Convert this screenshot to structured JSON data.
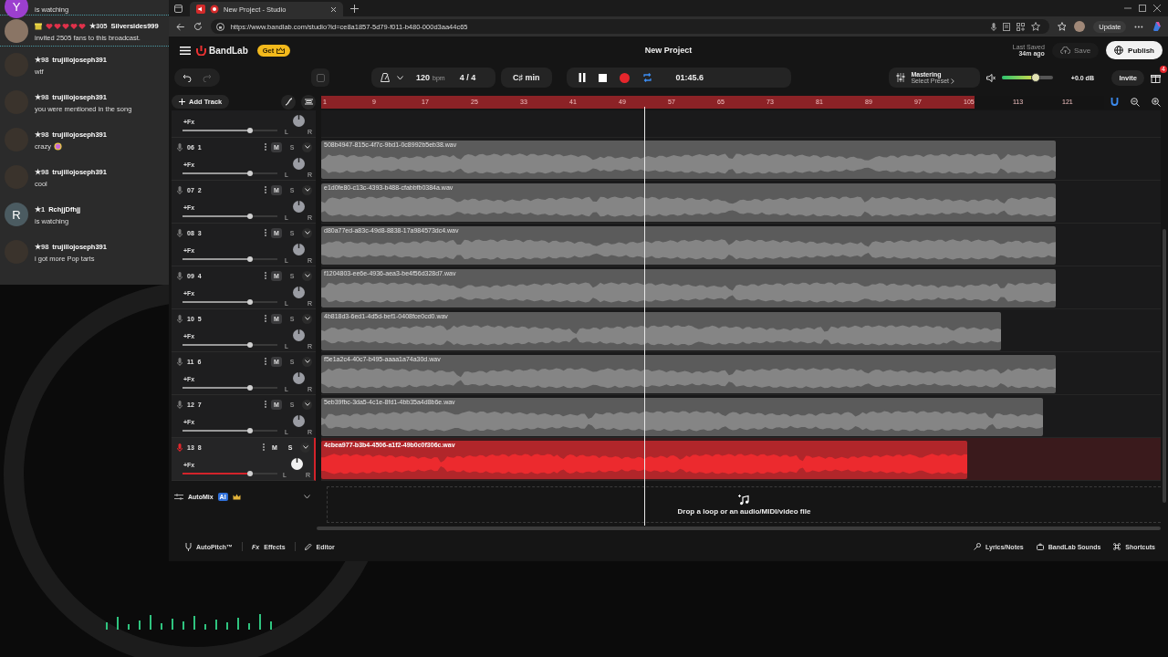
{
  "chat": {
    "messages": [
      {
        "kind": "letter",
        "avatar": "Y",
        "color": "#9c3fcf",
        "text": "is watching",
        "emoji": false
      },
      {
        "kind": "gift",
        "badge": "★305",
        "user": "Silversides999",
        "text": "invited 2505 fans to this broadcast.",
        "emoji": false
      },
      {
        "kind": "photo",
        "badge": "★98",
        "user": "trujillojoseph391",
        "text": "wtf",
        "emoji": false
      },
      {
        "kind": "photo",
        "badge": "★98",
        "user": "trujillojoseph391",
        "text": "you were mentioned in the song",
        "emoji": false
      },
      {
        "kind": "photo",
        "badge": "★98",
        "user": "trujillojoseph391",
        "text": "crazy",
        "emoji": true
      },
      {
        "kind": "photo",
        "badge": "★98",
        "user": "trujillojoseph391",
        "text": "cool",
        "emoji": false
      },
      {
        "kind": "letter",
        "avatar": "R",
        "color": "#4b5b61",
        "badge": "★1",
        "user": "RchjjDfhjj",
        "text": "is watching",
        "emoji": false
      },
      {
        "kind": "photo",
        "badge": "★98",
        "user": "trujillojoseph391",
        "text": "i got more Pop tarts",
        "emoji": false
      }
    ]
  },
  "browser": {
    "tab": {
      "title": "New Project - Studio"
    },
    "url": "https://www.bandlab.com/studio?id=ce8a1857-5d79-f011-b480-000d3aa44c65",
    "update": "Update"
  },
  "header": {
    "logo": "BandLab",
    "get": "Get",
    "title": "New Project",
    "last_saved_label": "Last Saved",
    "last_saved_time": "34m ago",
    "save": {
      "label": "Save",
      "disabled": true
    },
    "publish": "Publish"
  },
  "toolbar": {
    "tempo": "120",
    "tempo_unit": "bpm",
    "time_signature": "4 / 4",
    "key": "C♯ min",
    "transport": {
      "playing": true,
      "loop": true
    },
    "time": "01:45.6",
    "mastering": {
      "label": "Mastering",
      "preset": "Select Preset"
    },
    "master_volume": {
      "level": 0.65,
      "reading": "+0.0 dB"
    },
    "invite": "Invite",
    "gift_count": "4"
  },
  "add_track": "Add Track",
  "ruler": {
    "marks": [
      "1",
      "9",
      "17",
      "25",
      "33",
      "41",
      "49",
      "57",
      "65",
      "73",
      "81",
      "89",
      "97",
      "105",
      "113",
      "121"
    ],
    "loop_region": {
      "level": 0.835
    }
  },
  "playhead": {
    "level": 0.385
  },
  "tracks": [
    {
      "fx": "+Fx",
      "level": 0.71,
      "selected": false,
      "pan_left": "L",
      "pan_right": "R"
    },
    {
      "number": "06",
      "name": "1",
      "mute": "M",
      "solo": "S",
      "fx": "+Fx",
      "level": 0.71,
      "selected": false,
      "pan_left": "L",
      "pan_right": "R",
      "clip": {
        "name": "508b4947-815c-4f7c-9bd1-0c8992b5eb38.wav",
        "level": 0.875
      }
    },
    {
      "number": "07",
      "name": "2",
      "mute": "M",
      "solo": "S",
      "fx": "+Fx",
      "level": 0.71,
      "selected": false,
      "pan_left": "L",
      "pan_right": "R",
      "clip": {
        "name": "e1d0fe80-c13c-4393-b488-cfabbfb0384a.wav",
        "level": 0.875
      }
    },
    {
      "number": "08",
      "name": "3",
      "mute": "M",
      "solo": "S",
      "fx": "+Fx",
      "level": 0.71,
      "selected": false,
      "pan_left": "L",
      "pan_right": "R",
      "clip": {
        "name": "d80a77ed-a83c-49d8-8838-17a984573dc4.wav",
        "level": 0.875
      }
    },
    {
      "number": "09",
      "name": "4",
      "mute": "M",
      "solo": "S",
      "fx": "+Fx",
      "level": 0.71,
      "selected": false,
      "pan_left": "L",
      "pan_right": "R",
      "clip": {
        "name": "f1204803-ee6e-4936-aea3-be4f56d328d7.wav",
        "level": 0.875
      }
    },
    {
      "number": "10",
      "name": "5",
      "mute": "M",
      "solo": "S",
      "fx": "+Fx",
      "level": 0.71,
      "selected": false,
      "pan_left": "L",
      "pan_right": "R",
      "clip": {
        "name": "4b818d3-6ed1-4d5d-bef1-0408fce0cd0.wav",
        "level": 0.81
      }
    },
    {
      "number": "11",
      "name": "6",
      "mute": "M",
      "solo": "S",
      "fx": "+Fx",
      "level": 0.71,
      "selected": false,
      "pan_left": "L",
      "pan_right": "R",
      "clip": {
        "name": "f5e1a2c4-40c7-b495-aaaa1a74a30d.wav",
        "level": 0.875
      }
    },
    {
      "number": "12",
      "name": "7",
      "mute": "M",
      "solo": "S",
      "fx": "+Fx",
      "level": 0.71,
      "selected": false,
      "pan_left": "L",
      "pan_right": "R",
      "clip": {
        "name": "5eb39fbc-3da5-4c1e-8fd1-4bb35a4d8b6e.wav",
        "level": 0.86
      }
    },
    {
      "number": "13",
      "name": "8",
      "mute": "M",
      "solo": "S",
      "fx": "+Fx",
      "level": 0.71,
      "selected": true,
      "pan_left": "L",
      "pan_right": "R",
      "clip": {
        "name": "4cbea977-b3b4-4506-a1f2-49b0c0f306c.wav",
        "level": 0.77
      }
    }
  ],
  "automix": {
    "label": "AutoMix",
    "ai": "AI"
  },
  "drop_zone": "Drop a loop or an audio/MIDI/video file",
  "bottom_bar": {
    "left": [
      {
        "kind": "pitch",
        "label": "AutoPitch™"
      },
      {
        "kind": "fx",
        "prefix": "Fx",
        "label": "Effects"
      },
      {
        "kind": "pencil",
        "label": "Editor"
      }
    ],
    "right": [
      {
        "kind": "mic",
        "label": "Lyrics/Notes"
      },
      {
        "kind": "sounds",
        "label": "BandLab Sounds"
      },
      {
        "kind": "keys",
        "label": "Shortcuts"
      }
    ]
  }
}
